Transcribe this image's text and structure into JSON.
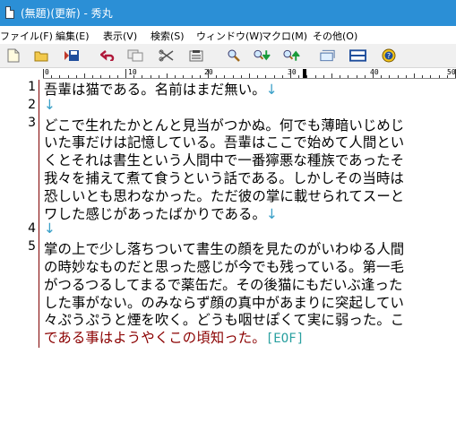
{
  "window": {
    "title": "(無題)(更新) - 秀丸"
  },
  "menu": {
    "items": [
      "ファイル(F)",
      "編集(E)",
      "表示(V)",
      "検索(S)",
      "ウィンドウ(W)",
      "マクロ(M)",
      "その他(O)"
    ]
  },
  "toolbar": {
    "buttons": [
      "new-file-icon",
      "open-folder-icon",
      "save-icon",
      "undo-icon",
      "copy-icon",
      "cut-icon",
      "paste-icon",
      "search-icon",
      "find-next-icon",
      "find-prev-icon",
      "grep-icon",
      "split-window-icon",
      "help-icon"
    ]
  },
  "ruler": {
    "labels": [
      "0",
      "10",
      "20",
      "30",
      "40",
      "50"
    ]
  },
  "editor": {
    "rows": [
      {
        "line": "1",
        "text": "吾輩は猫である。名前はまだ無い。",
        "mark": "↓"
      },
      {
        "line": "2",
        "text": "",
        "mark": "↓"
      },
      {
        "line": "3",
        "text": "どこで生れたかとんと見当がつかぬ。何でも薄暗いじめじ",
        "mark": ""
      },
      {
        "line": "",
        "text": "いた事だけは記憶している。吾輩はここで始めて人間とい",
        "mark": ""
      },
      {
        "line": "",
        "text": "くとそれは書生という人間中で一番獰悪な種族であったそ",
        "mark": ""
      },
      {
        "line": "",
        "text": "我々を捕えて煮て食うという話である。しかしその当時は",
        "mark": ""
      },
      {
        "line": "",
        "text": "恐しいとも思わなかった。ただ彼の掌に載せられてスーと",
        "mark": ""
      },
      {
        "line": "",
        "text": "ワした感じがあったばかりである。",
        "mark": "↓"
      },
      {
        "line": "4",
        "text": "",
        "mark": "↓"
      },
      {
        "line": "5",
        "text": "掌の上で少し落ちついて書生の顔を見たのがいわゆる人間",
        "mark": ""
      },
      {
        "line": "",
        "text": "の時妙なものだと思った感じが今でも残っている。第一毛",
        "mark": ""
      },
      {
        "line": "",
        "text": "がつるつるしてまるで薬缶だ。その後猫にもだいぶ逢った",
        "mark": ""
      },
      {
        "line": "",
        "text": "した事がない。のみならず顔の真中があまりに突起してい",
        "mark": ""
      },
      {
        "line": "",
        "text": "々ぷうぷうと煙を吹く。どうも咽せぽくて実に弱った。こ",
        "mark": ""
      },
      {
        "line": "",
        "text": "である事はようやくこの頃知った。",
        "mark": ""
      }
    ],
    "eof": "[EOF]"
  },
  "colors": {
    "titlebar": "#2b8fd6",
    "line_number_rule": "#800000",
    "newline_mark": "#3aa0c8",
    "eof": "#2aa0a0",
    "current_line": "#8b0000"
  }
}
